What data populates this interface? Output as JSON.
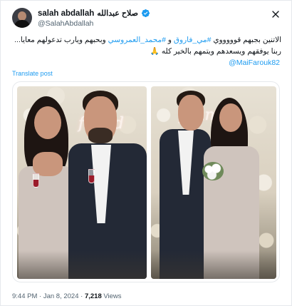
{
  "author": {
    "name": "salah abdallah",
    "name_ar": "صلاح عبدالله",
    "handle": "@SalahAbdallah"
  },
  "tweet": {
    "line1_start": "الاتنين بجبهم قوووووي ",
    "hashtag1": "#مي_فاروق",
    "line1_mid": " و ",
    "hashtag2": "#محمد_العمروسي",
    "line1_end": " وبحبهم ويارب تدعولهم معايا...",
    "line2": "ربنا يوفقهم ويسعدهم ويتمهم بالخير كله 🙏",
    "mention": "@MaiFarouk82"
  },
  "translate_label": "Translate post",
  "media": {
    "neon_left": "found",
    "neon_right": "found f"
  },
  "meta": {
    "time": "9:44 PM",
    "sep1": " · ",
    "date": "Jan 8, 2024",
    "sep2": " · ",
    "views_count": "7,218",
    "views_label": " Views"
  },
  "icons": {
    "verified": "verified-badge-icon",
    "close": "close-icon"
  },
  "colors": {
    "accent": "#1d9bf0",
    "text": "#0f1419",
    "muted": "#536471"
  }
}
